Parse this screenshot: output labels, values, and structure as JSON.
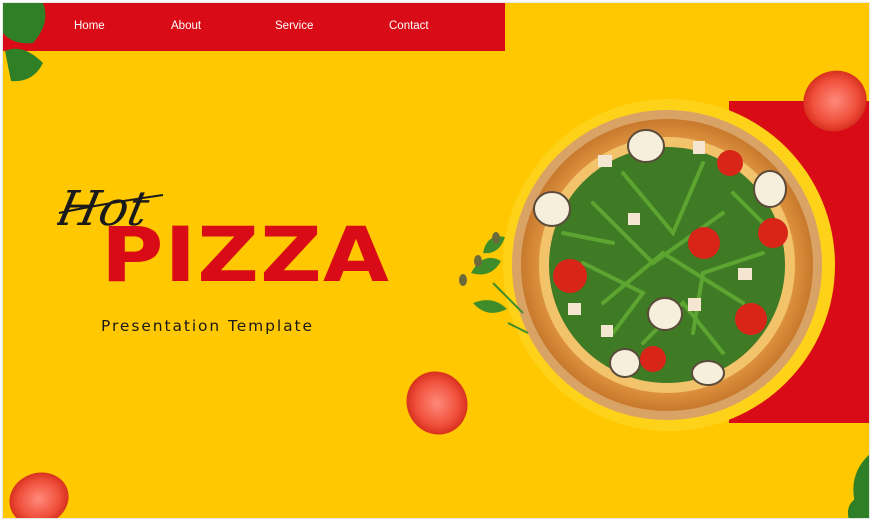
{
  "nav": {
    "items": [
      {
        "label": "Home"
      },
      {
        "label": "About"
      },
      {
        "label": "Service"
      },
      {
        "label": "Contact"
      }
    ]
  },
  "hero": {
    "script_word": "Hot",
    "title": "PIZZA",
    "subtitle": "Presentation Template"
  },
  "colors": {
    "background": "#ffc800",
    "accent_red": "#d90b16",
    "text_dark": "#1a1a1a"
  },
  "icons": [
    "basil-leaf-icon",
    "tomato-slice-icon",
    "pizza-image"
  ]
}
